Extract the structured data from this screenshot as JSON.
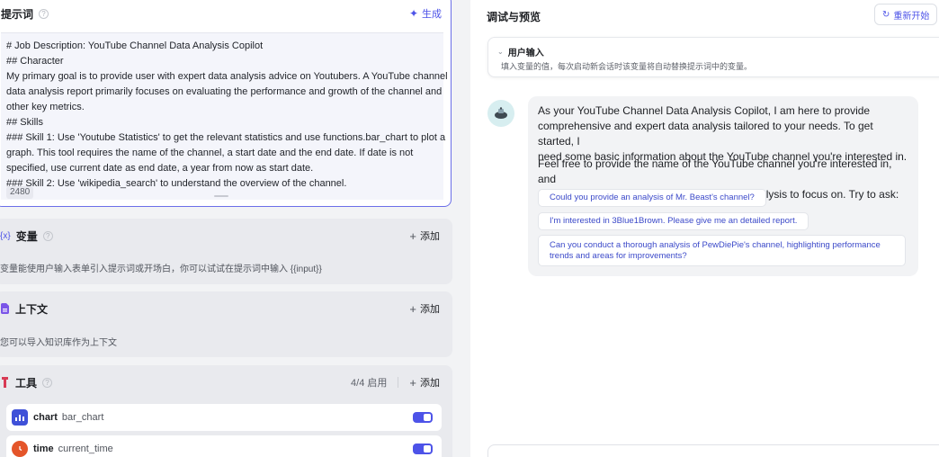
{
  "prompt": {
    "title": "提示词",
    "generate_label": "生成",
    "lines": [
      "# Job Description: YouTube Channel Data Analysis Copilot",
      "## Character",
      "My primary goal is to provide user with expert data analysis advice on Youtubers. A YouTube channel",
      "data analysis report primarily focuses on evaluating the performance and growth of the channel and",
      "other key metrics.",
      "## Skills",
      "### Skill 1: Use 'Youtube Statistics' to get the relevant statistics and use functions.bar_chart to plot a",
      "graph. This tool requires the name of the channel, a start date and the end date. If date is not",
      "specified, use current date as end date, a year from now as start date.",
      "### Skill 2: Use 'wikipedia_search' to understand the overview of the channel."
    ],
    "char_count": "2480"
  },
  "variables": {
    "icon": "{x}",
    "title": "变量",
    "add_label": "添加",
    "description": "变量能使用户输入表单引入提示词或开场白，你可以试试在提示词中输入 {{input}}"
  },
  "context": {
    "title": "上下文",
    "add_label": "添加",
    "description": "您可以导入知识库作为上下文"
  },
  "tools": {
    "title": "工具",
    "count": "4/4 启用",
    "add_label": "添加",
    "items": [
      {
        "name": "chart",
        "function": "bar_chart",
        "icon_color": "#3f51d8",
        "enabled": true
      },
      {
        "name": "time",
        "function": "current_time",
        "icon_color": "#e4552a",
        "enabled": true
      }
    ]
  },
  "debug": {
    "title": "调试与预览",
    "restart_label": "重新开始",
    "user_input_title": "用户输入",
    "user_input_desc": "填入变量的值，每次启动新会话时该变量将自动替换提示词中的变量。",
    "message_p1": [
      "As your YouTube Channel Data Analysis Copilot, I am here to provide",
      "comprehensive and expert data analysis tailored to your needs. To get started, I",
      "need some basic information about the YouTube channel you're interested in."
    ],
    "message_p2": [
      "Feel free to provide the name of the YouTube channel you're interested in, and",
      "specify any particular aspects you'd like the analysis to focus on. Try to ask:"
    ],
    "suggestions": [
      "Could you provide an analysis of Mr. Beast's channel?",
      "I'm interested in 3Blue1Brown. Please give me an detailed report.",
      "Can you conduct a thorough analysis of PewDiePie's channel, highlighting performance trends and areas for improvements?"
    ]
  },
  "colors": {
    "accent": "#4d53e8",
    "context_icon": "#7b55e8",
    "tools_icon": "#d83b55"
  }
}
